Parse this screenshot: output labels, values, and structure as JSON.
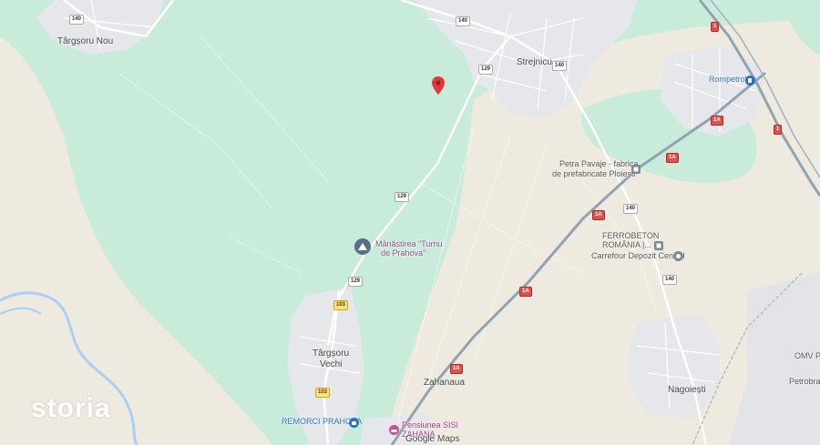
{
  "map": {
    "places": {
      "targsoru_nou": "Târgșoru Nou",
      "strejnicu": "Strejnicu",
      "targsoru_vechi_1": "Târgșoru",
      "targsoru_vechi_2": "Vechi",
      "zahanaua": "Zahanaua",
      "nagoiesti": "Nagoiești"
    },
    "pois": {
      "rompetrol": "Rompetrol",
      "petra_1": "Petra Pavaje - fabrica",
      "petra_2": "de prefabricate Ploiești",
      "ferrobeton_1": "FERROBETON",
      "ferrobeton_2": "ROMÂNIA |...",
      "carrefour": "Carrefour Depozit Central",
      "manastirea_1": "Mânăstirea \"Turnu",
      "manastirea_2": "de Prahova\"",
      "remorci": "REMORCI PRAHOVA",
      "pensiunea_1": "Pensiunea SISI",
      "pensiunea_2": "ZAHANA",
      "omv": "OMV Pe",
      "petrobraz": "Petrobraz"
    },
    "roads": {
      "r140_a": "140",
      "r140_b": "140",
      "r140_c": "140",
      "r140_d": "140",
      "r140_e": "140",
      "r129_a": "129",
      "r129_b": "129",
      "r129_c": "129",
      "r103_a": "103",
      "r103_b": "103",
      "r1a_a": "1A",
      "r1a_b": "1A",
      "r1a_c": "1A",
      "r1a_d": "1A",
      "r1a_e": "1A",
      "r1_a": "1",
      "r1_b": "1"
    },
    "watermark": "storia",
    "attribution": "Google Maps"
  },
  "colors": {
    "forest": "#c8ecd9",
    "field": "#eeeadf",
    "urban": "#e8e8ea",
    "river": "#a9cff3",
    "marker": "#e03a3a",
    "highway": "#8fa4b0"
  }
}
